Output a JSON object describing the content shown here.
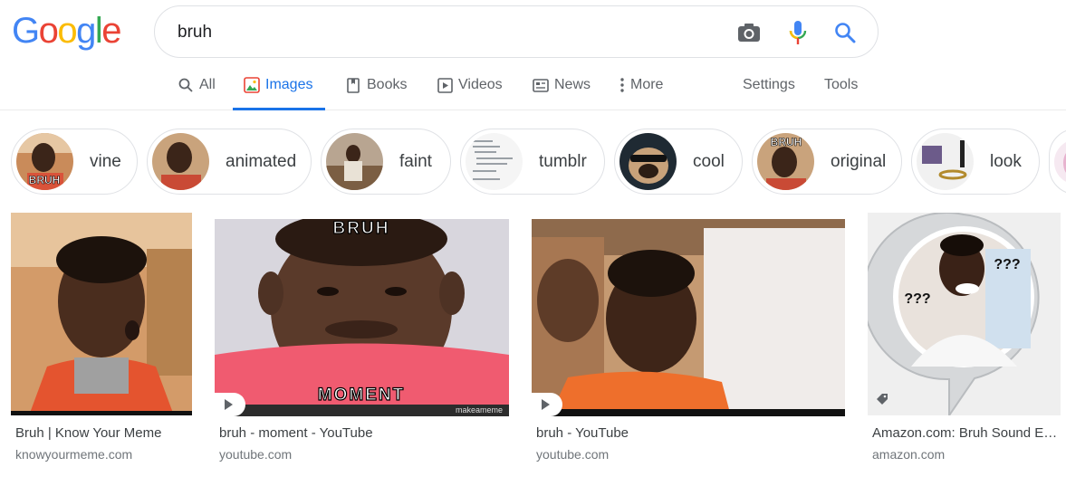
{
  "logo": {
    "letters": [
      "G",
      "o",
      "o",
      "g",
      "l",
      "e"
    ],
    "colors": [
      "#4285f4",
      "#ea4335",
      "#fbbc05",
      "#4285f4",
      "#34a853",
      "#ea4335"
    ]
  },
  "search": {
    "query": "bruh",
    "camera_icon": "camera-icon",
    "mic_icon": "mic-icon",
    "search_icon": "search-icon"
  },
  "tabs": {
    "all": "All",
    "images": "Images",
    "books": "Books",
    "videos": "Videos",
    "news": "News",
    "more": "More",
    "settings": "Settings",
    "tools": "Tools"
  },
  "chips": [
    {
      "label": "vine",
      "thumb_text": "BRUH"
    },
    {
      "label": "animated"
    },
    {
      "label": "faint"
    },
    {
      "label": "tumblr"
    },
    {
      "label": "cool"
    },
    {
      "label": "original",
      "thumb_text": "BRUH"
    },
    {
      "label": "look"
    }
  ],
  "results": [
    {
      "title": "Bruh | Know Your Meme",
      "source": "knowyourmeme.com"
    },
    {
      "title": "bruh - moment - YouTube",
      "source": "youtube.com",
      "overlay_top": "BRUH",
      "overlay_bottom": "MOMENT",
      "watermark": "makeameme"
    },
    {
      "title": "bruh - YouTube",
      "source": "youtube.com"
    },
    {
      "title": "Amazon.com: Bruh Sound E…",
      "source": "amazon.com",
      "overlay_left": "???",
      "overlay_right": "???"
    }
  ],
  "colors": {
    "accent": "#1a73e8",
    "muted": "#5f6368",
    "border": "#dfe1e5"
  }
}
